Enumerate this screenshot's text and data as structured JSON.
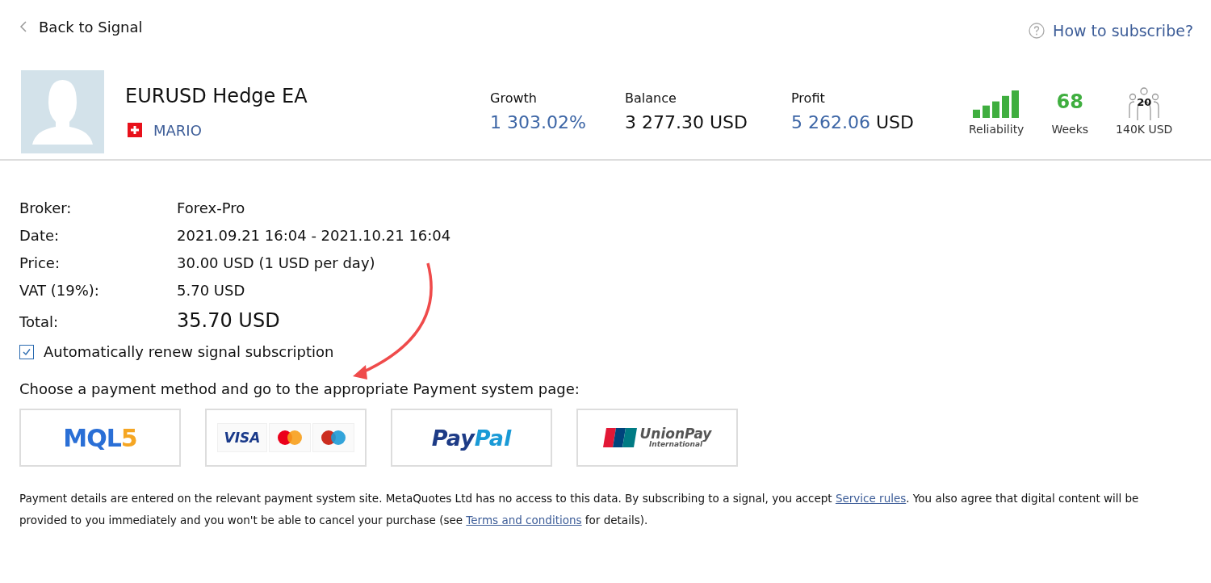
{
  "back_link": {
    "label": "Back to Signal"
  },
  "help_link": {
    "label": "How to subscribe?"
  },
  "signal": {
    "name": "EURUSD Hedge EA",
    "author": "MARIO"
  },
  "stats": [
    {
      "kind": "money",
      "label": "Growth",
      "value": "1 303.02%"
    },
    {
      "kind": "plain",
      "label": "Balance",
      "value": "3 277.30 USD"
    },
    {
      "kind": "split",
      "label": "Profit",
      "value": "5 262.06",
      "unit": "USD"
    }
  ],
  "reliability": {
    "label": "Reliability"
  },
  "weeks": {
    "value": "68",
    "label": "Weeks"
  },
  "subscribers": {
    "count": "20",
    "label": "140K USD"
  },
  "details": [
    {
      "label": "Broker:",
      "value": "Forex-Pro",
      "kind": "normal"
    },
    {
      "label": "Date:",
      "value": "2021.09.21 16:04 - 2021.10.21 16:04",
      "kind": "normal"
    },
    {
      "label": "Price:",
      "value": "30.00 USD (1 USD per day)",
      "kind": "normal"
    },
    {
      "label": "VAT (19%):",
      "value": "5.70 USD",
      "kind": "normal"
    },
    {
      "label": "Total:",
      "value": "35.70 USD",
      "kind": "total"
    }
  ],
  "auto_renew": {
    "label": "Automatically renew signal subscription",
    "checked": true
  },
  "payment_prompt": "Choose a payment method and go to the appropriate Payment system page:",
  "payment_methods": [
    {
      "kind": "mql5",
      "parts": [
        "MQL",
        "5"
      ]
    },
    {
      "kind": "cards",
      "parts": [
        "VISA"
      ]
    },
    {
      "kind": "paypal",
      "parts": [
        "Pay",
        "Pal"
      ]
    },
    {
      "kind": "unionpay",
      "parts": [
        "UnionPay",
        "International"
      ]
    }
  ],
  "disclaimer": [
    {
      "kind": "text",
      "text": "Payment details are entered on the relevant payment system site. MetaQuotes Ltd has no access to this data. By subscribing to a signal, you accept "
    },
    {
      "kind": "link",
      "text": "Service rules"
    },
    {
      "kind": "text",
      "text": ". You also agree that digital content will be provided to you immediately and you won't be able to cancel your purchase (see "
    },
    {
      "kind": "link",
      "text": "Terms and conditions"
    },
    {
      "kind": "text",
      "text": " for details)."
    }
  ]
}
